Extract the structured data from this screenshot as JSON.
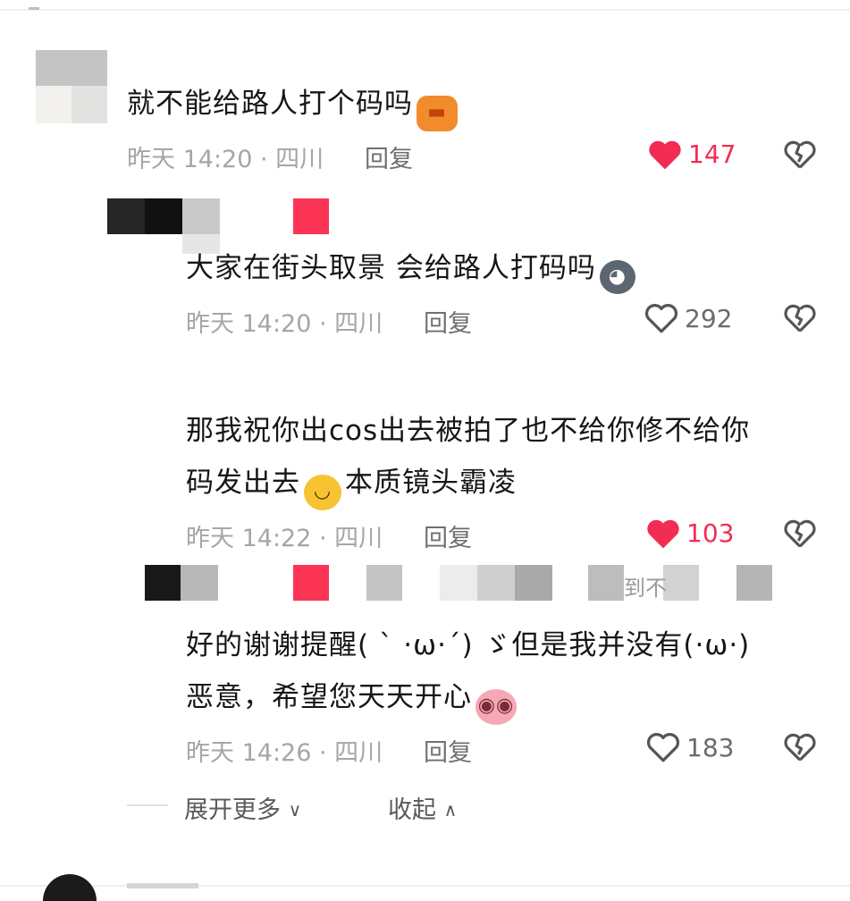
{
  "comments": [
    {
      "text": "就不能给路人打个码吗",
      "meta": "昨天 14:20 · 四川",
      "reply": "回复",
      "likes": "147",
      "liked": true
    },
    {
      "text": "大家在街头取景 会给路人打码吗",
      "meta": "昨天 14:20 · 四川",
      "reply": "回复",
      "likes": "292",
      "liked": false
    },
    {
      "text_line1": "那我祝你出cos出去被拍了也不给你修不给你",
      "text_line2a": "码发出去",
      "text_line2b": "本质镜头霸凌",
      "meta": "昨天 14:22 · 四川",
      "reply": "回复",
      "likes": "103",
      "liked": true
    },
    {
      "text_line1": "好的谢谢提醒( ` ·ω·´) ゞ但是我并没有(·ω·)",
      "text_line2": "恶意，希望您天天开心",
      "meta": "昨天 14:26 · 四川",
      "reply": "回复",
      "likes": "183",
      "liked": false
    }
  ],
  "reply_snippet": "到不",
  "footer": {
    "expand_more": "展开更多",
    "collapse": "收起"
  },
  "colors": {
    "like_red": "#f22c52",
    "meta_gray": "#a6a6a6"
  }
}
